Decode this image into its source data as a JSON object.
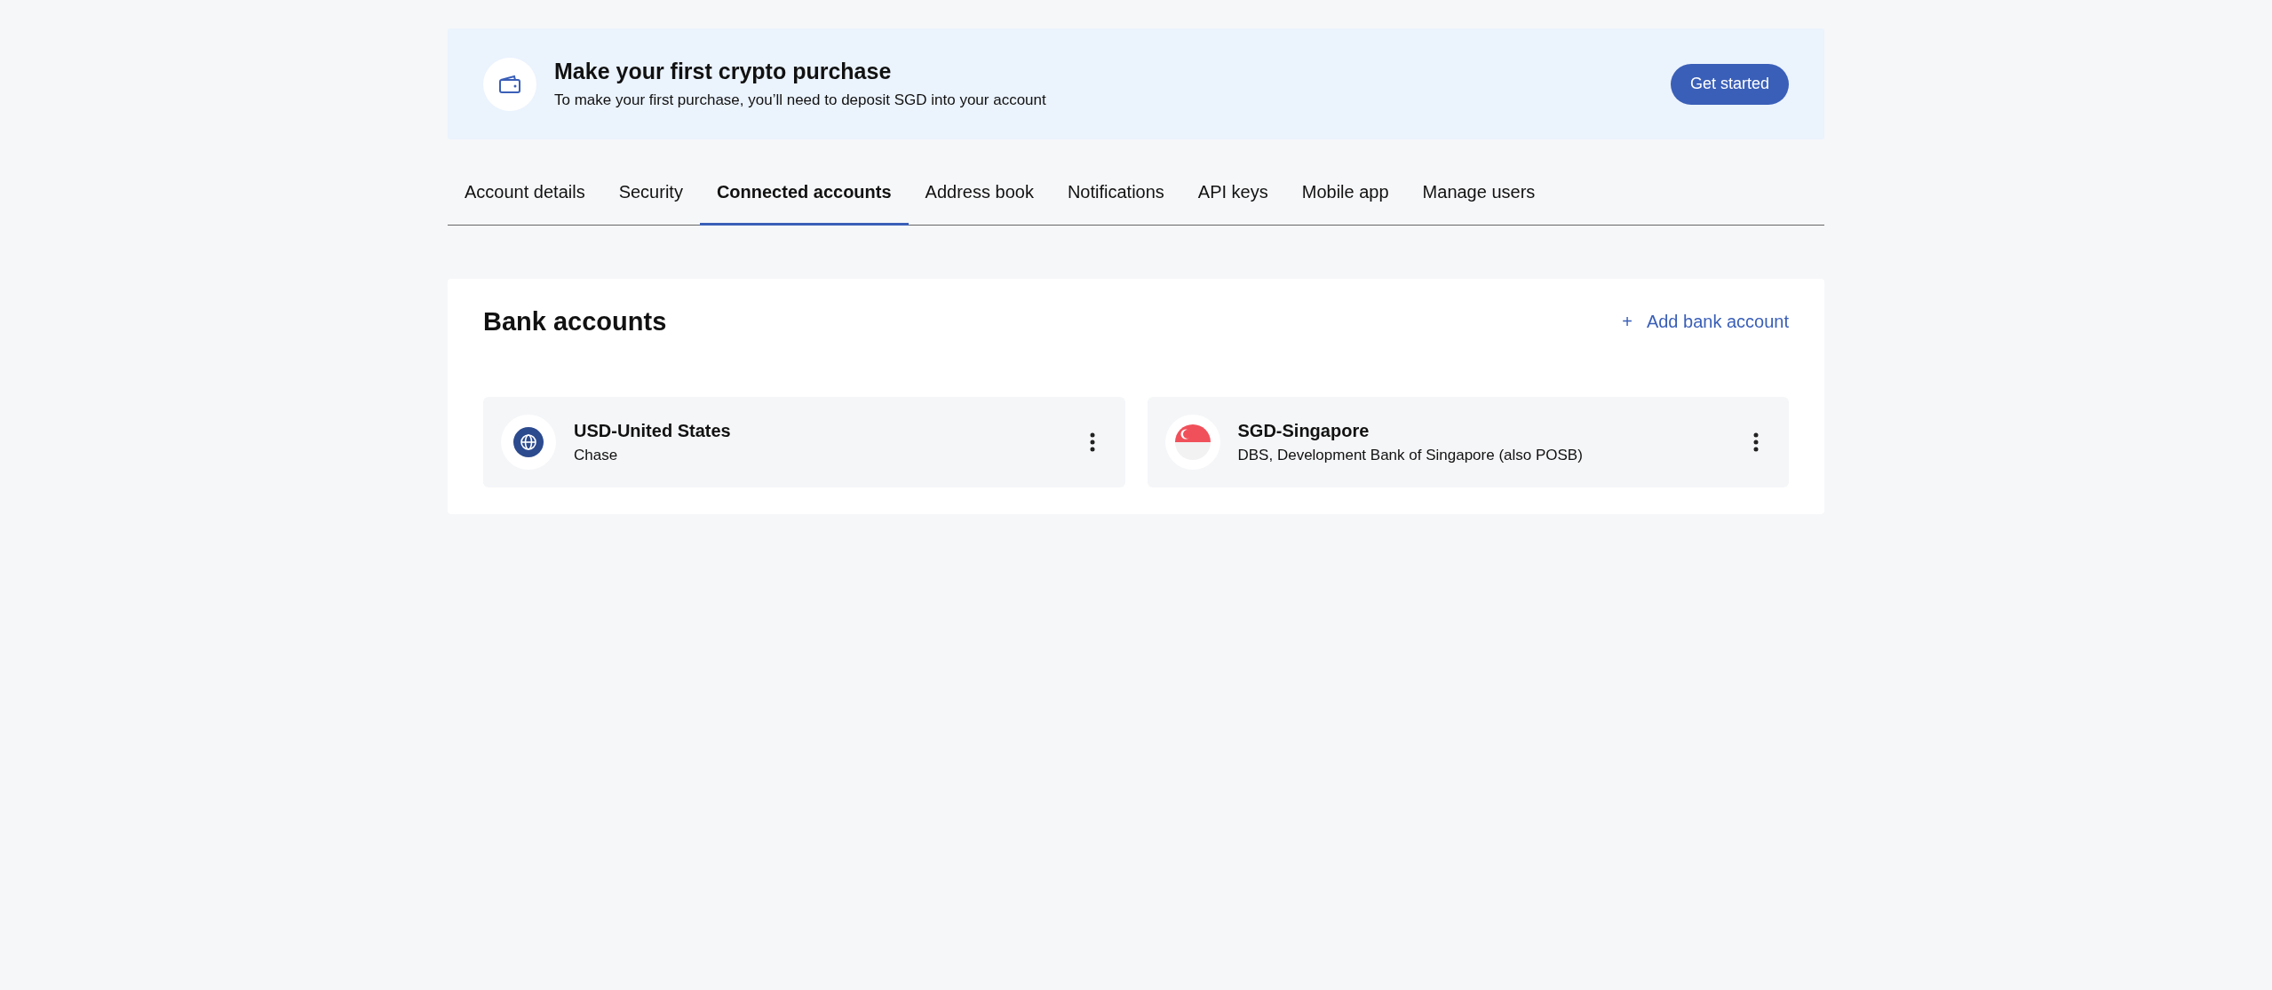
{
  "banner": {
    "title": "Make your first crypto purchase",
    "subtitle": "To make your first purchase, you’ll need to deposit SGD into your account",
    "button": "Get started"
  },
  "tabs": [
    {
      "label": "Account details",
      "selected": false
    },
    {
      "label": "Security",
      "selected": false
    },
    {
      "label": "Connected accounts",
      "selected": true
    },
    {
      "label": "Address book",
      "selected": false
    },
    {
      "label": "Notifications",
      "selected": false
    },
    {
      "label": "API keys",
      "selected": false
    },
    {
      "label": "Mobile app",
      "selected": false
    },
    {
      "label": "Manage users",
      "selected": false
    }
  ],
  "bank_accounts": {
    "title": "Bank accounts",
    "add_link": "+",
    "add_label": "Add bank account",
    "accounts": [
      {
        "kind": "globe",
        "name": "USD-United States",
        "bank": "Chase"
      },
      {
        "kind": "singapore-flag",
        "name": "SGD-Singapore",
        "bank": "DBS, Development Bank of Singapore (also POSB)"
      }
    ]
  }
}
